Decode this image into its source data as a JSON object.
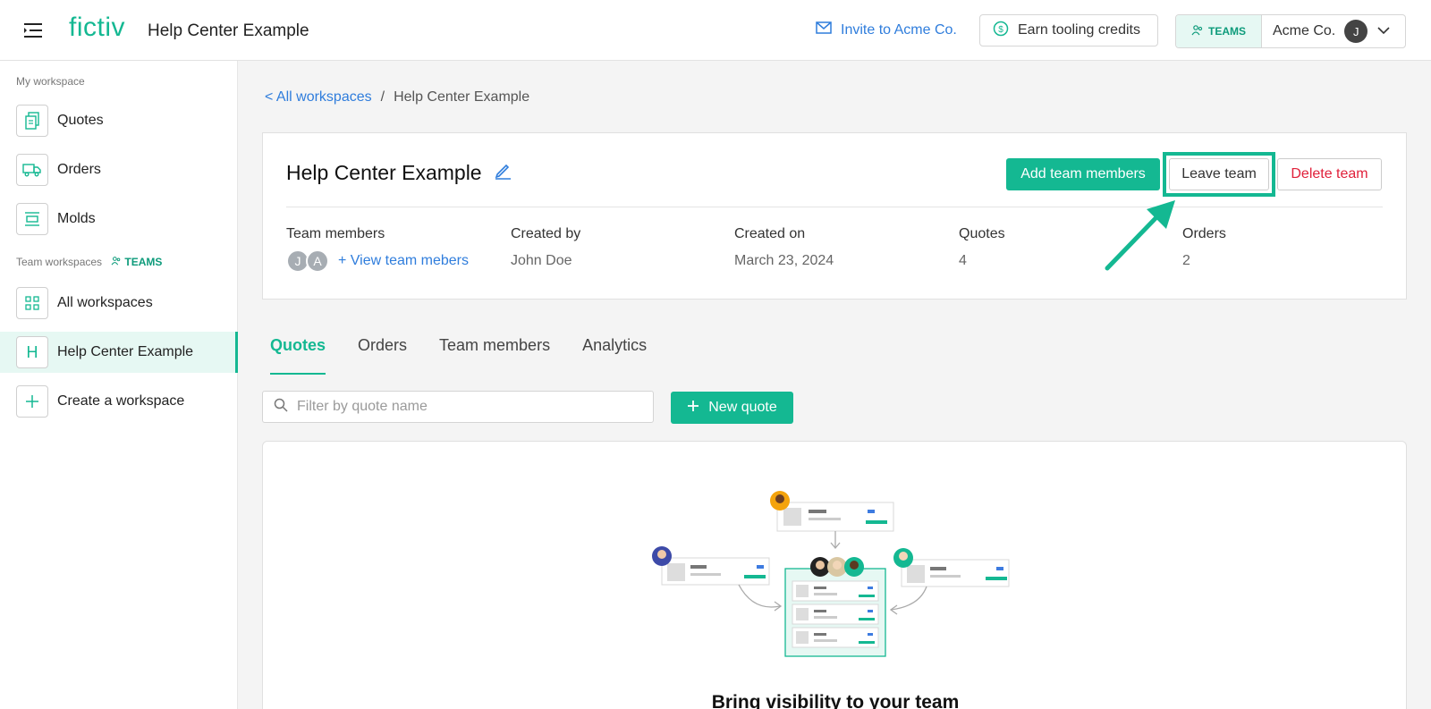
{
  "header": {
    "logo": "fictiv",
    "title": "Help Center Example",
    "invite_label": "Invite to Acme Co.",
    "earn_label": "Earn tooling credits",
    "teams_badge": "TEAMS",
    "account_name": "Acme Co.",
    "account_initial": "J"
  },
  "sidebar": {
    "my_workspace_label": "My workspace",
    "my_items": [
      {
        "label": "Quotes",
        "icon": "quotes-icon"
      },
      {
        "label": "Orders",
        "icon": "truck-icon"
      },
      {
        "label": "Molds",
        "icon": "mold-icon"
      }
    ],
    "team_workspaces_label": "Team workspaces",
    "teams_badge": "TEAMS",
    "team_items": [
      {
        "label": "All workspaces",
        "icon": "grid-icon"
      },
      {
        "label": "Help Center Example",
        "icon_letter": "H",
        "active": true
      },
      {
        "label": "Create a workspace",
        "icon": "plus-icon"
      }
    ]
  },
  "breadcrumb": {
    "back_label": "< All workspaces",
    "separator": "/",
    "current": "Help Center Example"
  },
  "team_card": {
    "title": "Help Center Example",
    "add_members_label": "Add team members",
    "leave_label": "Leave team",
    "delete_label": "Delete team",
    "meta": {
      "members_label": "Team members",
      "member_initials": [
        "J",
        "A"
      ],
      "view_members_label": "+ View team mebers",
      "created_by_label": "Created by",
      "created_by_value": "John Doe",
      "created_on_label": "Created on",
      "created_on_value": "March 23, 2024",
      "quotes_label": "Quotes",
      "quotes_value": "4",
      "orders_label": "Orders",
      "orders_value": "2"
    }
  },
  "tabs": [
    {
      "label": "Quotes",
      "active": true
    },
    {
      "label": "Orders"
    },
    {
      "label": "Team members"
    },
    {
      "label": "Analytics"
    }
  ],
  "filter": {
    "placeholder": "Filter by quote name"
  },
  "new_quote_label": "New quote",
  "empty_state": {
    "heading": "Bring visibility to your team"
  },
  "colors": {
    "accent": "#14b892",
    "link": "#2f7ddc",
    "danger": "#e0203a"
  }
}
